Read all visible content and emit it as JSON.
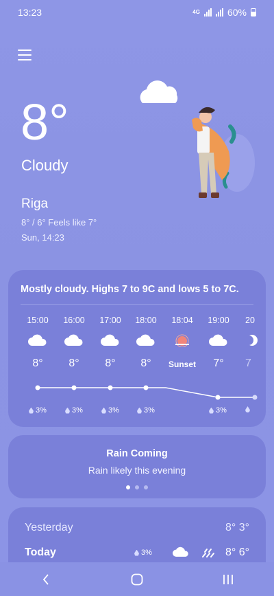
{
  "status_bar": {
    "time": "13:23",
    "network": "4G",
    "battery": "60%"
  },
  "current": {
    "temperature": "8°",
    "condition": "Cloudy",
    "city": "Riga",
    "hi_lo_feels": "8° / 6° Feels like 7°",
    "datetime": "Sun, 14:23"
  },
  "hourly": {
    "summary": "Mostly cloudy. Highs 7 to 9C and lows 5 to 7C.",
    "items": [
      {
        "time": "15:00",
        "icon": "cloud-icon",
        "temp": "8°",
        "precip": "3%"
      },
      {
        "time": "16:00",
        "icon": "cloud-icon",
        "temp": "8°",
        "precip": "3%"
      },
      {
        "time": "17:00",
        "icon": "cloud-icon",
        "temp": "8°",
        "precip": "3%"
      },
      {
        "time": "18:00",
        "icon": "cloud-icon",
        "temp": "8°",
        "precip": "3%"
      },
      {
        "time": "18:04",
        "icon": "sunset-icon",
        "temp": "Sunset",
        "precip": ""
      },
      {
        "time": "19:00",
        "icon": "cloud-icon",
        "temp": "7°",
        "precip": "3%"
      },
      {
        "time": "20",
        "icon": "moon-icon",
        "temp": "7",
        "precip": ""
      }
    ]
  },
  "rain_card": {
    "title": "Rain Coming",
    "subtitle": "Rain likely this evening",
    "active_page": 1,
    "page_count": 3
  },
  "daily": {
    "yesterday": {
      "label": "Yesterday",
      "temps": "8° 3°"
    },
    "today": {
      "label": "Today",
      "precip": "3%",
      "temps": "8° 6°"
    }
  },
  "colors": {
    "background": "#8e96e6",
    "card": "#7a80d9",
    "sunset": "#f0857b"
  }
}
